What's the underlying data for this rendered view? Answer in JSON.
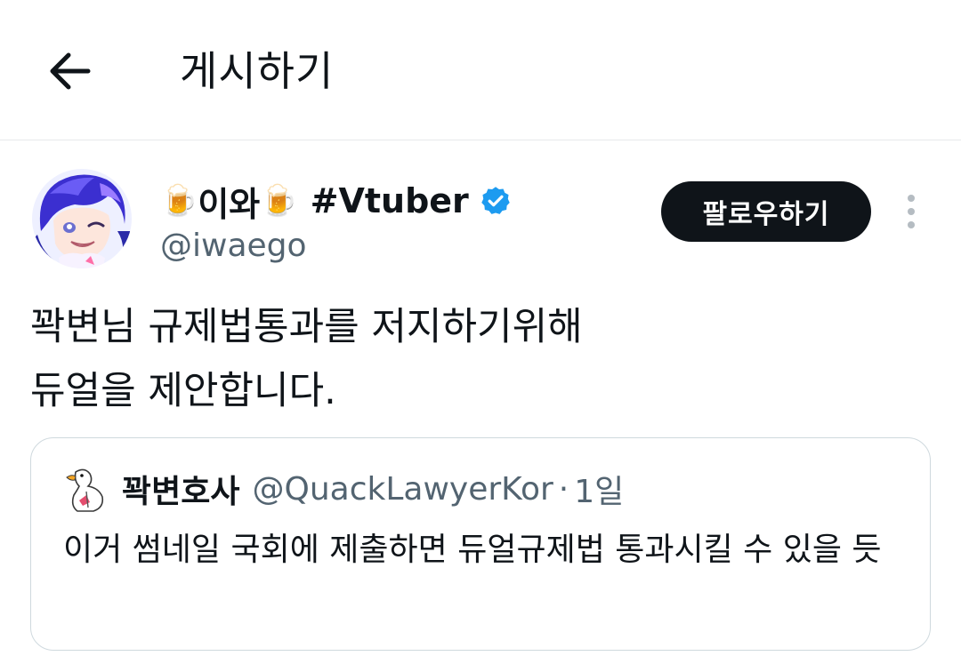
{
  "header": {
    "title": "게시하기",
    "back_icon": "arrow-left-icon"
  },
  "post": {
    "author_name_part1": "이와",
    "author_name_part2": "#Vtuber",
    "author_emoji": "🍺",
    "verified_icon": "verified-badge-icon",
    "handle": "@iwaego",
    "follow_label": "팔로우하기",
    "more_icon": "more-vertical-icon",
    "text_lines": [
      "꽉변님 규제법통과를 저지하기위해",
      "듀얼을 제안합니다."
    ]
  },
  "quote": {
    "name": "꽉변호사",
    "handle": "@QuackLawyerKor",
    "separator": "·",
    "time": "1일",
    "text": "이거 썸네일 국회에 제출하면 듀얼규제법 통과시킬 수 있을 듯"
  },
  "colors": {
    "text": "#0f1419",
    "secondary": "#536471",
    "follow_bg": "#0f1419",
    "verified": "#1d9bf0",
    "border": "#cfd9de"
  }
}
